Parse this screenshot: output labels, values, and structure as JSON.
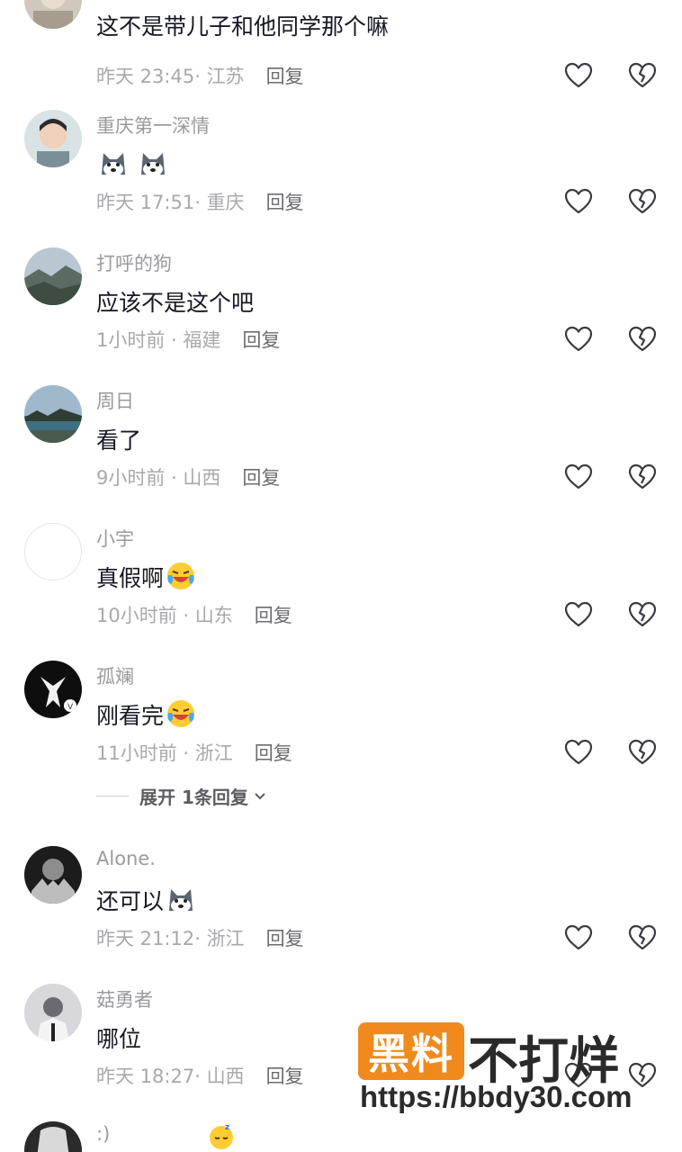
{
  "comments": [
    {
      "name": "",
      "text": "这不是带儿子和他同学那个嘛",
      "time": "昨天 23:45",
      "location": "江苏",
      "reply": "回复"
    },
    {
      "name": "重庆第一深情",
      "text": "",
      "time": "昨天 17:51",
      "location": "重庆",
      "reply": "回复"
    },
    {
      "name": "打呼的狗",
      "text": "应该不是这个吧",
      "time": "1小时前",
      "location": "福建",
      "reply": "回复"
    },
    {
      "name": "周日",
      "text": "看了",
      "time": "9小时前",
      "location": "山西",
      "reply": "回复"
    },
    {
      "name": "小宇",
      "text": "真假啊",
      "time": "10小时前",
      "location": "山东",
      "reply": "回复"
    },
    {
      "name": "孤斓",
      "text": "刚看完",
      "time": "11小时前",
      "location": "浙江",
      "reply": "回复"
    },
    {
      "name": "Alone.",
      "text": "还可以",
      "time": "昨天 21:12",
      "location": "浙江",
      "reply": "回复"
    },
    {
      "name": "菇勇者",
      "text": "哪位",
      "time": "昨天 18:27",
      "location": "山西",
      "reply": "回复"
    },
    {
      "name": ":)",
      "text": "",
      "time": "",
      "location": "",
      "reply": ""
    }
  ],
  "expand_label": "展开 1条回复",
  "watermark": {
    "brand_box": "黑料",
    "brand_text": "不打烊",
    "url": "https://bbdy30.com"
  },
  "colors": {
    "accent": "#f08a1c",
    "text": "#161823",
    "muted": "#a8a8ad"
  }
}
